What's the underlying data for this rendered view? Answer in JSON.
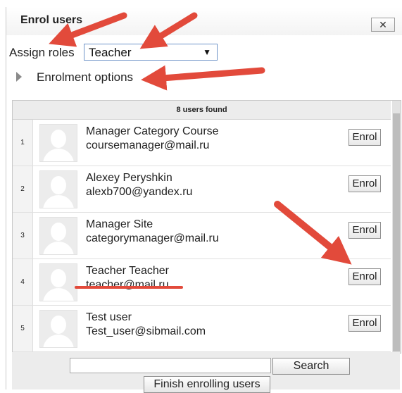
{
  "dialog": {
    "title": "Enrol users",
    "close_glyph": "✕",
    "close_icon": "close-icon"
  },
  "assign": {
    "label": "Assign roles",
    "selected_role": "Teacher",
    "caret_glyph": "▼"
  },
  "options": {
    "label": "Enrolment options",
    "expand_icon": "triangle-right-icon"
  },
  "results": {
    "found_text": "8 users found",
    "enrol_label": "Enrol",
    "users": [
      {
        "num": "1",
        "name": "Manager Category Course",
        "email": "coursemanager@mail.ru"
      },
      {
        "num": "2",
        "name": "Alexey Peryshkin",
        "email": "alexb700@yandex.ru"
      },
      {
        "num": "3",
        "name": "Manager Site",
        "email": "categorymanager@mail.ru"
      },
      {
        "num": "4",
        "name": "Teacher Teacher",
        "email": "teacher@mail.ru"
      },
      {
        "num": "5",
        "name": "Test user",
        "email": "Test_user@sibmail.com"
      }
    ]
  },
  "footer": {
    "search_value": "",
    "search_label": "Search",
    "finish_label": "Finish enrolling users"
  },
  "colors": {
    "annotation_red": "#e24a3b",
    "select_border": "#6f94c8"
  }
}
